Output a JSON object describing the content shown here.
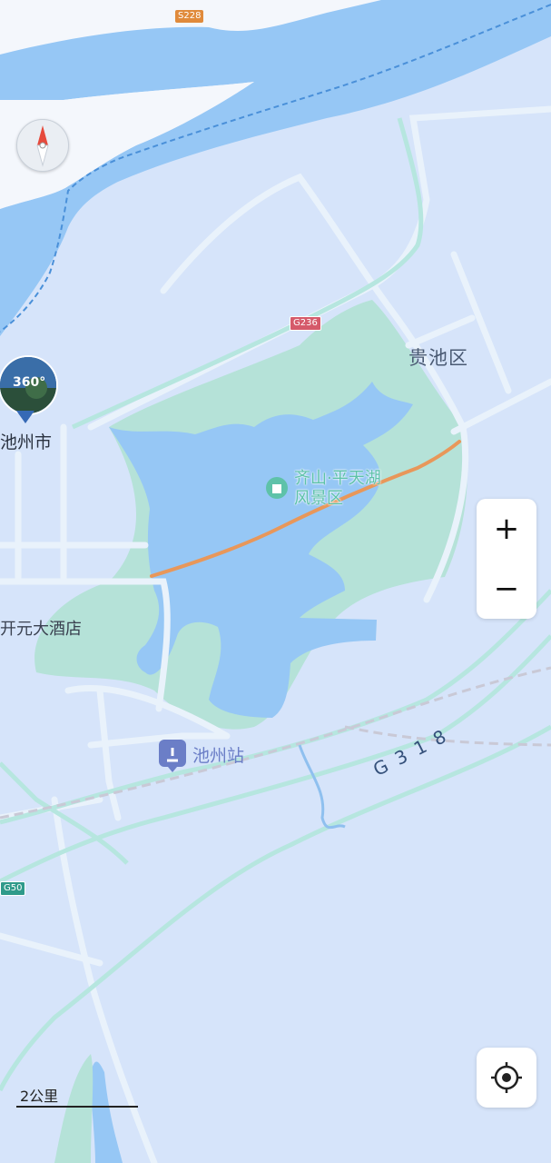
{
  "map": {
    "labels": {
      "district": "贵池区",
      "city": "池州市",
      "hotel": "开元大酒店",
      "scenic_line1": "齐山·平天湖",
      "scenic_line2": "风景区",
      "station": "池州站"
    },
    "road_shields": {
      "s228": "S228",
      "g236": "G236",
      "g50": "G50",
      "g318": "G318"
    },
    "panorama_badge": "360°",
    "scale_label": "2公里"
  },
  "controls": {
    "zoom_in": "+",
    "zoom_out": "−"
  },
  "colors": {
    "land": "#d6e4fa",
    "water": "#96c7f5",
    "green": "#b5e2d8",
    "road": "#e9f2fb",
    "route": "#e8975a"
  }
}
